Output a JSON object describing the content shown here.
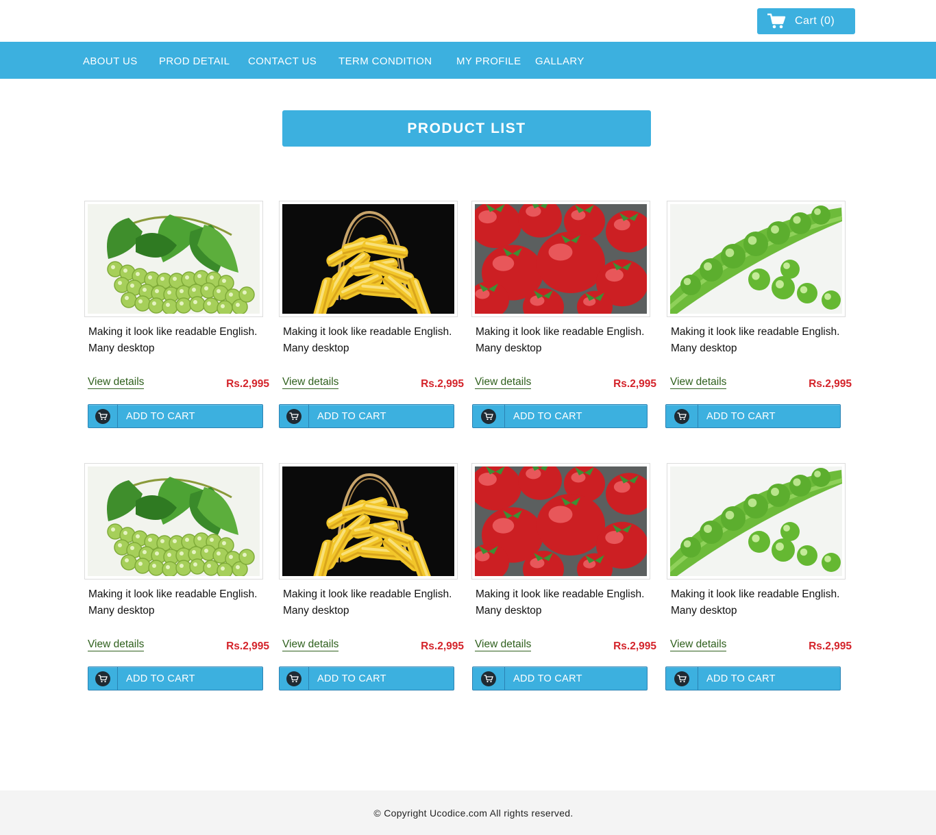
{
  "header": {
    "cart_label": "Cart (0)",
    "cart_icon": "shopping-cart-icon"
  },
  "nav": {
    "items": [
      {
        "label": "ABOUT US"
      },
      {
        "label": "PROD DETAIL"
      },
      {
        "label": "CONTACT US"
      },
      {
        "label": "TERM CONDITION"
      },
      {
        "label": "MY PROFILE"
      },
      {
        "label": "GALLARY"
      }
    ]
  },
  "main": {
    "heading": "PRODUCT LIST",
    "products": [
      {
        "image": "grapes",
        "description": "Making it look like readable English. Many desktop",
        "view_label": "View details",
        "price": "Rs.2,995",
        "button_label": "ADD TO CART"
      },
      {
        "image": "corn",
        "description": "Making it look like readable English. Many desktop",
        "view_label": "View details",
        "price": "Rs.2,995",
        "button_label": "ADD TO CART"
      },
      {
        "image": "strawberries",
        "description": "Making it look like readable English. Many desktop",
        "view_label": "View details",
        "price": "Rs.2,995",
        "button_label": "ADD TO CART"
      },
      {
        "image": "peas",
        "description": "Making it look like readable English. Many desktop",
        "view_label": "View details",
        "price": "Rs.2,995",
        "button_label": "ADD TO CART"
      },
      {
        "image": "grapes",
        "description": "Making it look like readable English. Many desktop",
        "view_label": "View details",
        "price": "Rs.2,995",
        "button_label": "ADD TO CART"
      },
      {
        "image": "corn",
        "description": "Making it look like readable English. Many desktop",
        "view_label": "View details",
        "price": "Rs.2,995",
        "button_label": "ADD TO CART"
      },
      {
        "image": "strawberries",
        "description": "Making it look like readable English. Many desktop",
        "view_label": "View details",
        "price": "Rs.2,995",
        "button_label": "ADD TO CART"
      },
      {
        "image": "peas",
        "description": "Making it look like readable English. Many desktop",
        "view_label": "View details",
        "price": "Rs.2,995",
        "button_label": "ADD TO CART"
      }
    ]
  },
  "footer": {
    "copyright": "© Copyright Ucodice.com All rights reserved."
  },
  "colors": {
    "accent": "#3cb0df",
    "price": "#d4232a",
    "link": "#2e5f1c"
  }
}
